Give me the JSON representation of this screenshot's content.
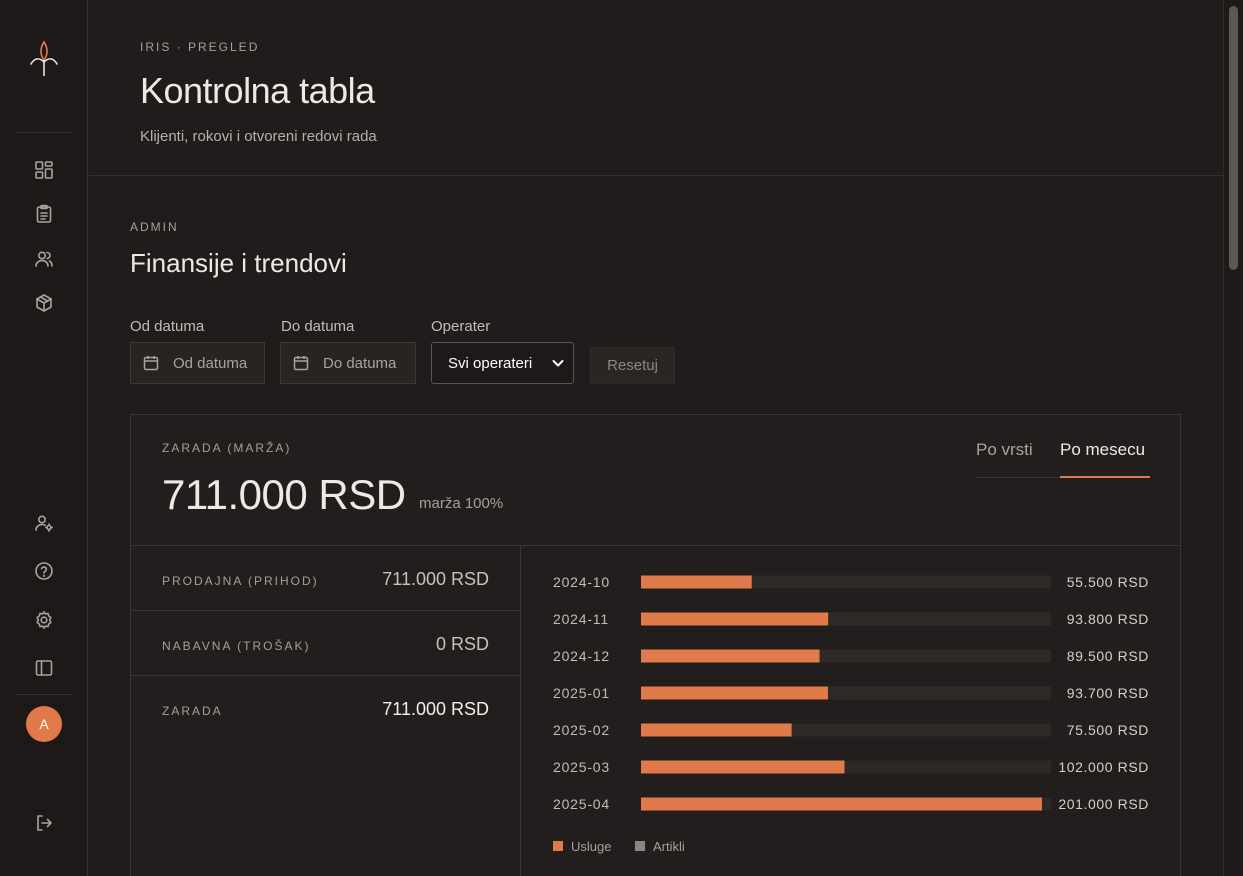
{
  "colors": {
    "accent": "#e07a4a",
    "bg": "#201c1b",
    "secondary_legend": "#8a8581"
  },
  "sidebar": {
    "logo": "iris-flower-logo",
    "nav_top": [
      {
        "name": "dashboard-icon"
      },
      {
        "name": "clipboard-list-icon"
      },
      {
        "name": "users-icon"
      },
      {
        "name": "package-icon"
      }
    ],
    "nav_bottom": [
      {
        "name": "user-settings-icon"
      },
      {
        "name": "help-circle-icon"
      },
      {
        "name": "gear-icon"
      },
      {
        "name": "sidebar-toggle-icon"
      }
    ],
    "avatar_initial": "A",
    "logout_icon": "logout-icon"
  },
  "header": {
    "eyebrow": "IRIS · PREGLED",
    "title": "Kontrolna tabla",
    "subtitle": "Klijenti, rokovi i otvoreni redovi rada"
  },
  "section": {
    "eyebrow": "ADMIN",
    "title": "Finansije i trendovi"
  },
  "filters": {
    "from_label": "Od datuma",
    "from_placeholder": "Od datuma",
    "to_label": "Do datuma",
    "to_placeholder": "Do datuma",
    "operator_label": "Operater",
    "operator_value": "Svi operateri",
    "reset_label": "Resetuj"
  },
  "card": {
    "eyebrow": "ZARADA (MARŽA)",
    "amount": "711.000 RSD",
    "margin_note": "marža 100%",
    "tabs": [
      {
        "label": "Po vrsti",
        "active": false
      },
      {
        "label": "Po mesecu",
        "active": true
      }
    ],
    "summary": [
      {
        "label": "PRODAJNA (PRIHOD)",
        "value": "711.000 RSD"
      },
      {
        "label": "NABAVNA (TROŠAK)",
        "value": "0 RSD"
      },
      {
        "label": "ZARADA",
        "value": "711.000 RSD"
      }
    ]
  },
  "chart_data": {
    "type": "bar",
    "orientation": "horizontal",
    "stacked": true,
    "categories": [
      "2024-10",
      "2024-11",
      "2024-12",
      "2025-01",
      "2025-02",
      "2025-03",
      "2025-04"
    ],
    "series": [
      {
        "name": "Usluge",
        "values": [
          55500,
          93800,
          89500,
          93700,
          75500,
          102000,
          201000
        ]
      },
      {
        "name": "Artikli",
        "values": [
          0,
          0,
          0,
          0,
          0,
          0,
          0
        ]
      }
    ],
    "value_labels": [
      "55.500 RSD",
      "93.800 RSD",
      "89.500 RSD",
      "93.700 RSD",
      "75.500 RSD",
      "102.000 RSD",
      "201.000 RSD"
    ],
    "xlim": [
      0,
      201000
    ],
    "legend_position": "bottom-left"
  }
}
